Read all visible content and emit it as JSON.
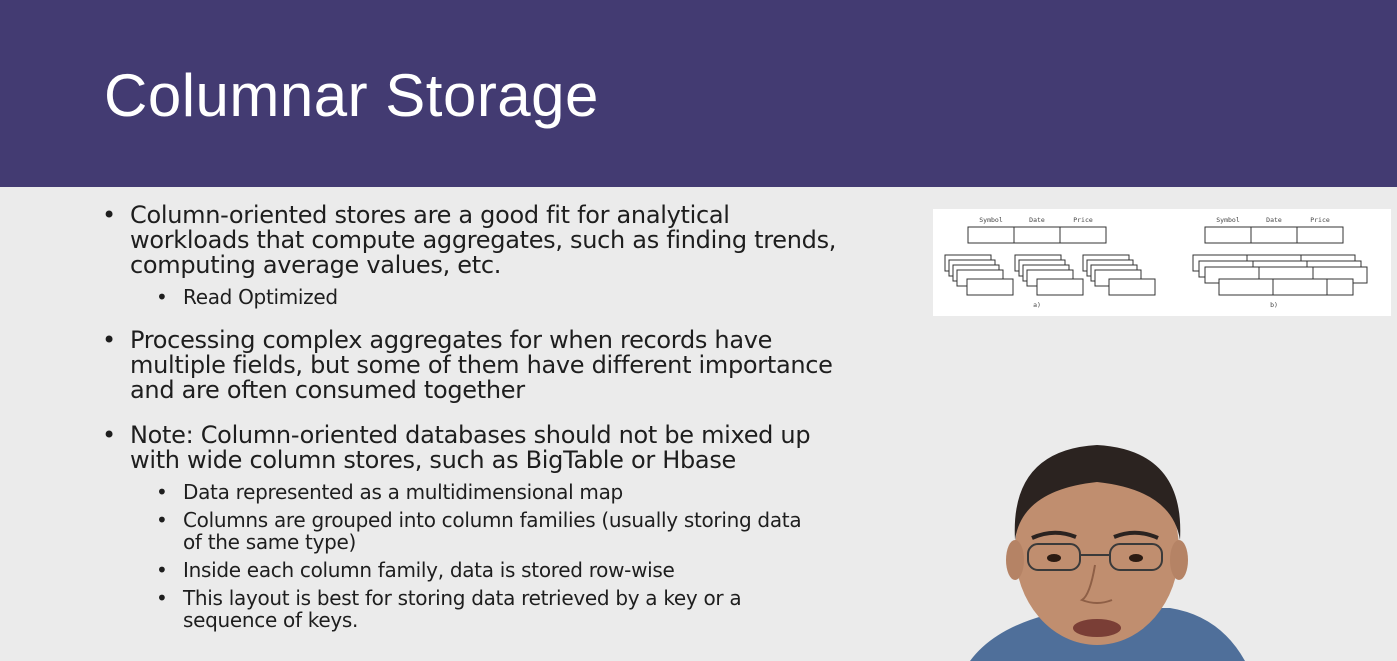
{
  "slide": {
    "title": "Columnar Storage"
  },
  "bullets": [
    {
      "text": "Column-oriented stores are a good fit for analytical workloads that compute aggregates, such as finding trends, computing average values, etc.",
      "lines": [
        "Column-oriented stores are a good fit for analytical",
        "workloads that compute aggregates, such as finding trends,",
        "computing average values, etc."
      ],
      "sub": [
        {
          "lines": [
            "Read Optimized"
          ]
        }
      ]
    },
    {
      "text": "Processing complex aggregates for when records have multiple fields, but some of them have different importance and are often consumed together",
      "lines": [
        "Processing complex aggregates for when records have",
        "multiple fields, but some of them have different importance",
        "and are often consumed together"
      ],
      "sub": []
    },
    {
      "text": "Note: Column-oriented databases should not be mixed up with wide column stores, such as BigTable or Hbase",
      "lines": [
        "Note: Column-oriented databases should not be mixed up",
        "with wide column stores, such as BigTable or Hbase"
      ],
      "sub": [
        {
          "lines": [
            "Data represented as a multidimensional map"
          ]
        },
        {
          "lines": [
            "Columns are grouped into column families (usually storing data",
            "of the same type)"
          ]
        },
        {
          "lines": [
            "Inside each column family, data is stored row-wise"
          ]
        },
        {
          "lines": [
            "This layout is best for storing data retrieved by a key or a",
            "sequence of keys."
          ]
        }
      ]
    }
  ],
  "diagram": {
    "left": {
      "headers": [
        "Symbol",
        "Date",
        "Price"
      ],
      "caption": "a)"
    },
    "right": {
      "headers": [
        "Symbol",
        "Date",
        "Price"
      ],
      "caption": "b)"
    }
  }
}
